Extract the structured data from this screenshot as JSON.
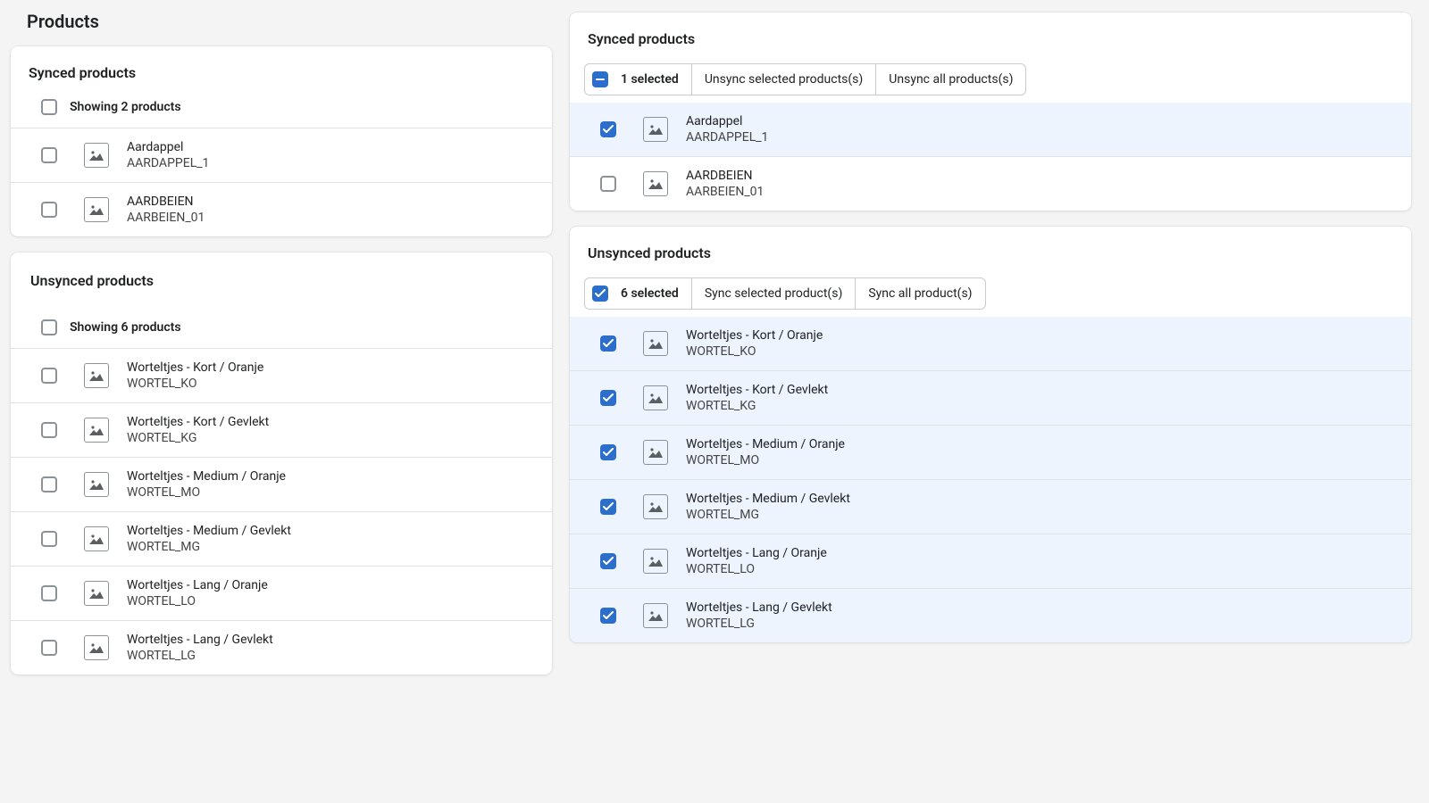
{
  "page_title": "Products",
  "left": {
    "synced": {
      "title": "Synced products",
      "showing": "Showing 2 products",
      "items": [
        {
          "name": "Aardappel",
          "sku": "AARDAPPEL_1"
        },
        {
          "name": "AARDBEIEN",
          "sku": "AARBEIEN_01"
        }
      ]
    },
    "unsynced": {
      "title": "Unsynced products",
      "showing": "Showing 6 products",
      "items": [
        {
          "name": "Worteltjes - Kort / Oranje",
          "sku": "WORTEL_KO"
        },
        {
          "name": "Worteltjes - Kort / Gevlekt",
          "sku": "WORTEL_KG"
        },
        {
          "name": "Worteltjes - Medium / Oranje",
          "sku": "WORTEL_MO"
        },
        {
          "name": "Worteltjes - Medium / Gevlekt",
          "sku": "WORTEL_MG"
        },
        {
          "name": "Worteltjes - Lang / Oranje",
          "sku": "WORTEL_LO"
        },
        {
          "name": "Worteltjes - Lang / Gevlekt",
          "sku": "WORTEL_LG"
        }
      ]
    }
  },
  "right": {
    "synced": {
      "title": "Synced products",
      "selected_text": "1 selected",
      "action1": "Unsync selected products(s)",
      "action2": "Unsync all products(s)",
      "items": [
        {
          "name": "Aardappel",
          "sku": "AARDAPPEL_1",
          "checked": true
        },
        {
          "name": "AARDBEIEN",
          "sku": "AARBEIEN_01",
          "checked": false
        }
      ]
    },
    "unsynced": {
      "title": "Unsynced products",
      "selected_text": "6 selected",
      "action1": "Sync selected product(s)",
      "action2": "Sync all product(s)",
      "items": [
        {
          "name": "Worteltjes - Kort / Oranje",
          "sku": "WORTEL_KO",
          "checked": true
        },
        {
          "name": "Worteltjes - Kort / Gevlekt",
          "sku": "WORTEL_KG",
          "checked": true
        },
        {
          "name": "Worteltjes - Medium / Oranje",
          "sku": "WORTEL_MO",
          "checked": true
        },
        {
          "name": "Worteltjes - Medium / Gevlekt",
          "sku": "WORTEL_MG",
          "checked": true
        },
        {
          "name": "Worteltjes - Lang / Oranje",
          "sku": "WORTEL_LO",
          "checked": true
        },
        {
          "name": "Worteltjes - Lang / Gevlekt",
          "sku": "WORTEL_LG",
          "checked": true
        }
      ]
    }
  }
}
